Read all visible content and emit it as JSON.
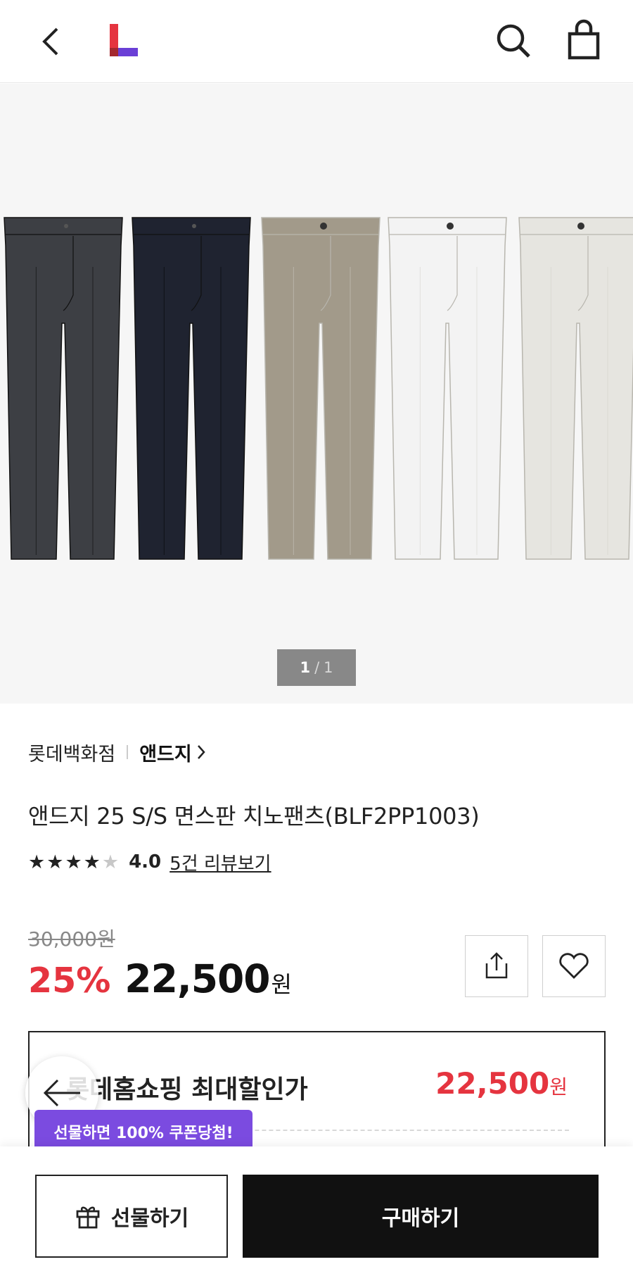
{
  "header": {
    "back_icon": "chevron-left-icon",
    "logo_icon": "lotte-l-logo",
    "search_icon": "search-icon",
    "bag_icon": "shopping-bag-icon"
  },
  "gallery": {
    "current": "1",
    "separator": "/",
    "total": "1",
    "colors": [
      "#3d3f44",
      "#1f2330",
      "#a29a8a",
      "#f3f3f3",
      "#e6e5e0"
    ]
  },
  "product": {
    "store": "롯데백화점",
    "brand": "앤드지",
    "brand_arrow": ">",
    "title": "앤드지 25 S/S 면스판 치노팬츠(BLF2PP1003)",
    "rating": {
      "stars_filled": 4,
      "stars_total": 5,
      "score": "4.0",
      "review_link": "5건 리뷰보기"
    },
    "original_price": "30,000원",
    "discount": "25%",
    "price": "22,500",
    "currency": "원"
  },
  "max_discount": {
    "label": "롯데홈쇼핑 최대할인가",
    "value": "22,500",
    "currency": "원"
  },
  "gift_tooltip": "선물하면 100% 쿠폰당첨!",
  "bottom_bar": {
    "gift_label": "선물하기",
    "buy_label": "구매하기"
  },
  "colors": {
    "accent_red": "#e5343f",
    "tooltip_purple": "#7b4be0",
    "logo_red": "#e5343f",
    "logo_purple": "#6a3fd6"
  }
}
